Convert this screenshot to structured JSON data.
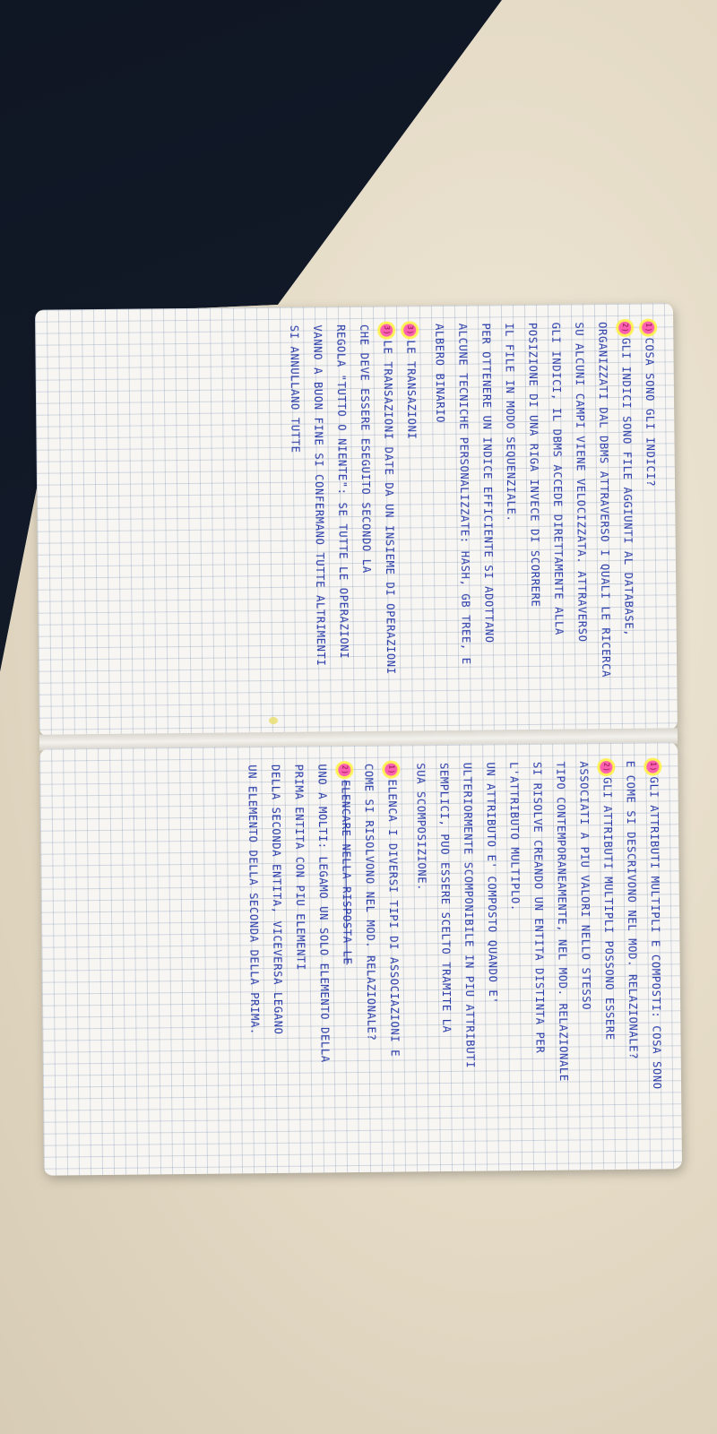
{
  "notes": {
    "top_page": [
      {
        "marker": "1)",
        "text": "COSA SONO GLI INDICI?"
      },
      {
        "marker": "2)",
        "text": "GLI INDICI SONO FILE AGGIUNTI AL DATABASE,"
      },
      {
        "marker": "",
        "text": "ORGANIZZATI DAL DBMS ATTRAVERSO I QUALI LE RICERCA"
      },
      {
        "marker": "",
        "text": "SU ALCUNI CAMPI VIENE VELOCIZZATA. ATTRAVERSO"
      },
      {
        "marker": "",
        "text": "GLI INDICI, IL DBMS ACCEDE DIRETTAMENTE ALLA"
      },
      {
        "marker": "",
        "text": "POSIZIONE DI UNA RIGA INVECE DI SCORRERE"
      },
      {
        "marker": "",
        "text": "IL FILE IN MODO SEQUENZIALE."
      },
      {
        "marker": "",
        "text": "PER OTTENERE UN INDICE EFFICIENTE SI ADOTTANO"
      },
      {
        "marker": "",
        "text": "ALCUNE TECNICHE PERSONALIZZATE: HASH, GB TREE, E"
      },
      {
        "marker": "",
        "text": "ALBERO BINARIO"
      },
      {
        "marker": "3)",
        "text": "LE TRANSAZIONI",
        "gap": true
      },
      {
        "marker": "3)",
        "text": "LE TRANSAZIONI DATE DA UN INSIEME DI OPERAZIONI"
      },
      {
        "marker": "",
        "text": "CHE DEVE ESSERE ESEGUITO SECONDO LA"
      },
      {
        "marker": "",
        "text": "REGOLA \"TUTTO O NIENTE\": SE TUTTE LE OPERAZIONI"
      },
      {
        "marker": "",
        "text": "VANNO A BUON FINE SI CONFERMANO TUTTE ALTRIMENTI"
      },
      {
        "marker": "",
        "text": "SI ANNULLANO TUTTE"
      }
    ],
    "bottom_page": [
      {
        "marker": "1)",
        "text": "GLI ATTRIBUTI MULTIPLI E COMPOSTI: COSA SONO"
      },
      {
        "marker": "",
        "text": "E COME SI DESCRIVONO NEL MOD. RELAZIONALE?"
      },
      {
        "marker": "2)",
        "text": "GLI ATTRIBUTI MULTIPLI POSSONO ESSERE"
      },
      {
        "marker": "",
        "text": "ASSOCIATI A PIU VALORI NELLO STESSO"
      },
      {
        "marker": "",
        "text": "TIPO CONTEMPORANEAMENTE, NEL MOD. RELAZIONALE"
      },
      {
        "marker": "",
        "text": "SI RISOLVE CREANDO UN ENTITA DISTINTA PER"
      },
      {
        "marker": "",
        "text": "L'ATTRIBUTO MULTIPLO."
      },
      {
        "marker": "",
        "text": "UN ATTRIBUTO E' COMPOSTO QUANDO E'"
      },
      {
        "marker": "",
        "text": "ULTERIORMENTE SCOMPONIBILE IN PIU ATTRIBUTI"
      },
      {
        "marker": "",
        "text": "SEMPLICI, PUO ESSERE SCELTO TRAMITE LA"
      },
      {
        "marker": "",
        "text": "SUA SCOMPOSIZIONE."
      },
      {
        "marker": "1)",
        "text": "ELENCA I DIVERSI TIPI DI ASSOCIAZIONI E",
        "gap": true
      },
      {
        "marker": "",
        "text": "COME SI RISOLVONO NEL MOD. RELAZIONALE?"
      },
      {
        "marker": "2)",
        "text": "ELENCARE NELLA RISPOSTA LE",
        "strike": true
      },
      {
        "marker": "",
        "text": "UNO A MOLTI: LEGAMO UN SOLO ELEMENTO DELLA"
      },
      {
        "marker": "",
        "text": "PRIMA ENTITA CON PIU ELEMENTI"
      },
      {
        "marker": "",
        "text": "DELLA SECONDA ENTITA, VICEVERSA LEGANO"
      },
      {
        "marker": "",
        "text": "UN ELEMENTO DELLA SECONDA DELLA PRIMA."
      }
    ]
  }
}
